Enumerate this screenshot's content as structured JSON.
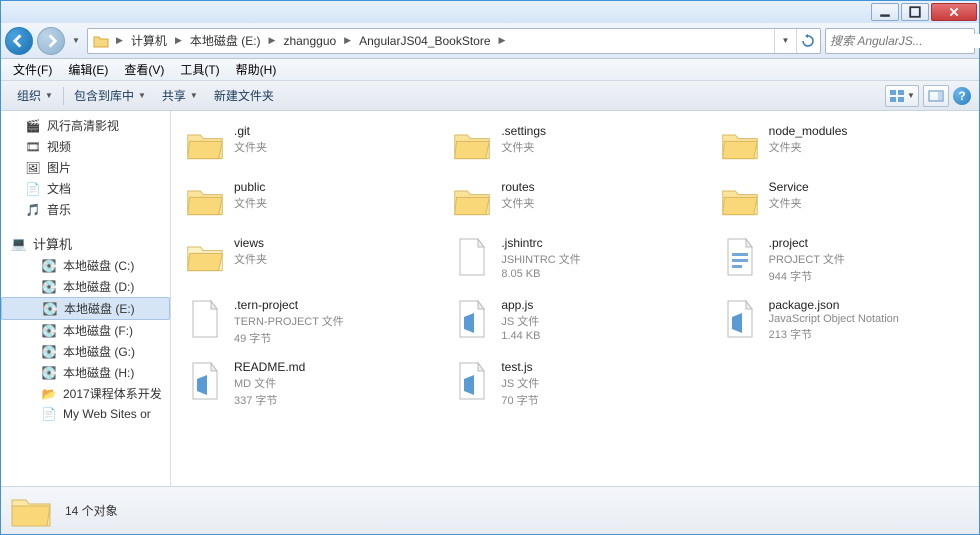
{
  "breadcrumb": {
    "parts": [
      "计算机",
      "本地磁盘 (E:)",
      "zhangguo",
      "AngularJS04_BookStore"
    ]
  },
  "search": {
    "placeholder": "搜索 AngularJS..."
  },
  "menubar": {
    "file": "文件(F)",
    "edit": "编辑(E)",
    "view": "查看(V)",
    "tools": "工具(T)",
    "help": "帮助(H)"
  },
  "toolbar": {
    "organize": "组织",
    "include": "包含到库中",
    "share": "共享",
    "newfolder": "新建文件夹"
  },
  "sidebar": {
    "funshion": "风行高清影视",
    "video": "视频",
    "pictures": "图片",
    "documents": "文档",
    "music": "音乐",
    "computer": "计算机",
    "drive_c": "本地磁盘 (C:)",
    "drive_d": "本地磁盘 (D:)",
    "drive_e": "本地磁盘 (E:)",
    "drive_f": "本地磁盘 (F:)",
    "drive_g": "本地磁盘 (G:)",
    "drive_h": "本地磁盘 (H:)",
    "course2017": "2017课程体系开发",
    "mywebsites": "My Web Sites or"
  },
  "items": [
    {
      "name": ".git",
      "type": "文件夹",
      "size": "",
      "icon": "folder"
    },
    {
      "name": ".settings",
      "type": "文件夹",
      "size": "",
      "icon": "folder"
    },
    {
      "name": "node_modules",
      "type": "文件夹",
      "size": "",
      "icon": "folder"
    },
    {
      "name": "public",
      "type": "文件夹",
      "size": "",
      "icon": "folder"
    },
    {
      "name": "routes",
      "type": "文件夹",
      "size": "",
      "icon": "folder"
    },
    {
      "name": "Service",
      "type": "文件夹",
      "size": "",
      "icon": "folder"
    },
    {
      "name": "views",
      "type": "文件夹",
      "size": "",
      "icon": "folder-light"
    },
    {
      "name": ".jshintrc",
      "type": "JSHINTRC 文件",
      "size": "8.05 KB",
      "icon": "file"
    },
    {
      "name": ".project",
      "type": "PROJECT 文件",
      "size": "944 字节",
      "icon": "file-doc"
    },
    {
      "name": ".tern-project",
      "type": "TERN-PROJECT 文件",
      "size": "49 字节",
      "icon": "file"
    },
    {
      "name": "app.js",
      "type": "JS 文件",
      "size": "1.44 KB",
      "icon": "file-js"
    },
    {
      "name": "package.json",
      "type": "JavaScript Object Notation",
      "size": "213 字节",
      "icon": "file-js"
    },
    {
      "name": "README.md",
      "type": "MD 文件",
      "size": "337 字节",
      "icon": "file-js"
    },
    {
      "name": "test.js",
      "type": "JS 文件",
      "size": "70 字节",
      "icon": "file-js"
    }
  ],
  "status": {
    "count": "14 个对象"
  }
}
